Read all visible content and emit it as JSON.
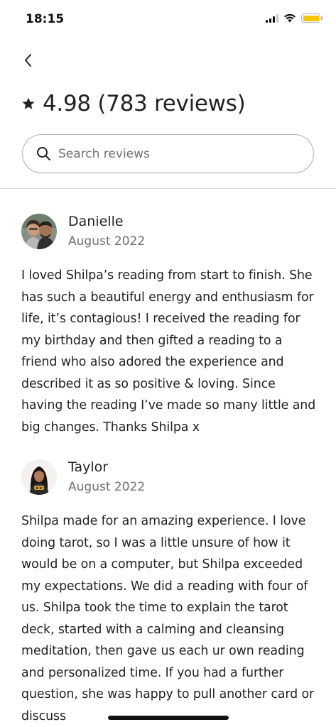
{
  "status_bar": {
    "time": "18:15",
    "battery_level": 1.0,
    "colors": {
      "battery": "#f5c400"
    }
  },
  "header": {
    "back_icon": "chevron-left-icon",
    "star_icon": "star-icon",
    "title": "4.98 (783 reviews)"
  },
  "search": {
    "placeholder": "Search reviews",
    "icon": "search-icon"
  },
  "reviews": [
    {
      "name": "Danielle",
      "date": "August 2022",
      "text": "I loved Shilpa’s reading from start to finish. She has such a beautiful energy and enthusiasm for life, it’s contagious! I received the reading for my birthday and then gifted a reading to a friend who also adored the experience and described it as so positive & loving. Since having the reading I’ve made so many little and big changes. Thanks Shilpa x"
    },
    {
      "name": "Taylor",
      "date": "August 2022",
      "text": "Shilpa made for an amazing experience. I love doing tarot, so I was a little unsure of how it would be on a computer, but Shilpa exceeded my expectations. We did a reading with four of us. Shilpa took the time to explain the tarot deck, started with a calming and cleansing meditation, then gave us each ur own reading and personalized time. If you had a further question, she was happy to pull another card or discuss"
    }
  ]
}
